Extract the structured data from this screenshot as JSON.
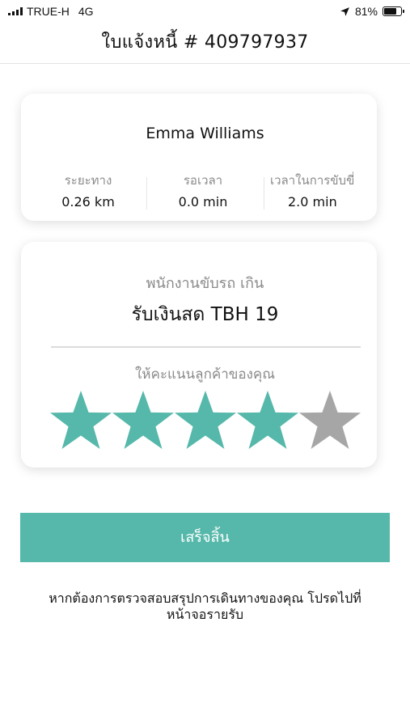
{
  "status_bar": {
    "carrier": "TRUE-H",
    "network": "4G",
    "battery_percent": "81%",
    "battery_level": 0.81,
    "location_icon": "location-arrow-icon"
  },
  "header": {
    "title": "ใบแจ้งหนี้ # 409797937"
  },
  "trip": {
    "driver_name": "Emma Williams",
    "stats": [
      {
        "label": "ระยะทาง",
        "value": "0.26 km"
      },
      {
        "label": "รอเวลา",
        "value": "0.0 min"
      },
      {
        "label": "เวลาในการขับขี่",
        "value": "2.0 min"
      }
    ]
  },
  "payment": {
    "caption": "พนักงานขับรถ เกิน",
    "amount_text": "รับเงินสด TBH 19",
    "rating_caption": "ให้คะแนนลูกค้าของคุณ",
    "rating": 4,
    "rating_max": 5,
    "star_colors": {
      "filled": "#55b8aa",
      "empty": "#a6a6a6"
    }
  },
  "actions": {
    "done_label": "เสร็จสิ้น",
    "accent_color": "#55b8aa"
  },
  "footnote": {
    "line1": "หากต้องการตรวจสอบสรุปการเดินทางของคุณ โปรดไปที่",
    "line2": "หน้าจอรายรับ"
  }
}
